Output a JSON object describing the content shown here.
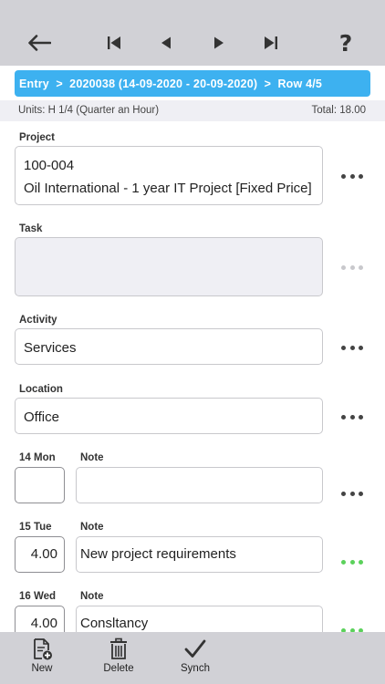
{
  "nav": {
    "back_icon": "back-arrow-icon",
    "first_icon": "first-record-icon",
    "prev_icon": "previous-record-icon",
    "next_icon": "next-record-icon",
    "last_icon": "last-record-icon",
    "help_label": "?"
  },
  "breadcrumb": {
    "entry": "Entry",
    "sep1": ">",
    "period": "2020038 (14-09-2020 - 20-09-2020)",
    "sep2": ">",
    "row": "Row 4/5",
    "color": "#3db1f0"
  },
  "units_bar": {
    "units": "Units: H 1/4 (Quarter an Hour)",
    "total": "Total:  18.00"
  },
  "form": {
    "project": {
      "label": "Project",
      "code": "100-004",
      "name": "Oil International - 1 year IT Project [Fixed Price]"
    },
    "task": {
      "label": "Task",
      "value": ""
    },
    "activity": {
      "label": "Activity",
      "value": "Services"
    },
    "location": {
      "label": "Location",
      "value": "Office"
    }
  },
  "days": [
    {
      "day": "14 Mon",
      "note_label": "Note",
      "hours": "",
      "note": "",
      "more_state": "normal"
    },
    {
      "day": "15 Tue",
      "note_label": "Note",
      "hours": "4.00",
      "note": "New project requirements",
      "more_state": "green"
    },
    {
      "day": "16 Wed",
      "note_label": "Note",
      "hours": "4.00",
      "note": "Consltancy",
      "more_state": "green"
    }
  ],
  "toolbar": {
    "new_label": "New",
    "delete_label": "Delete",
    "synch_label": "Synch",
    "new_icon": "new-document-icon",
    "delete_icon": "trash-icon",
    "synch_icon": "checkmark-icon"
  },
  "colors": {
    "bar_gray": "#d1d1d6",
    "accent_blue": "#3db1f0",
    "dots_green": "#5bd15b"
  }
}
